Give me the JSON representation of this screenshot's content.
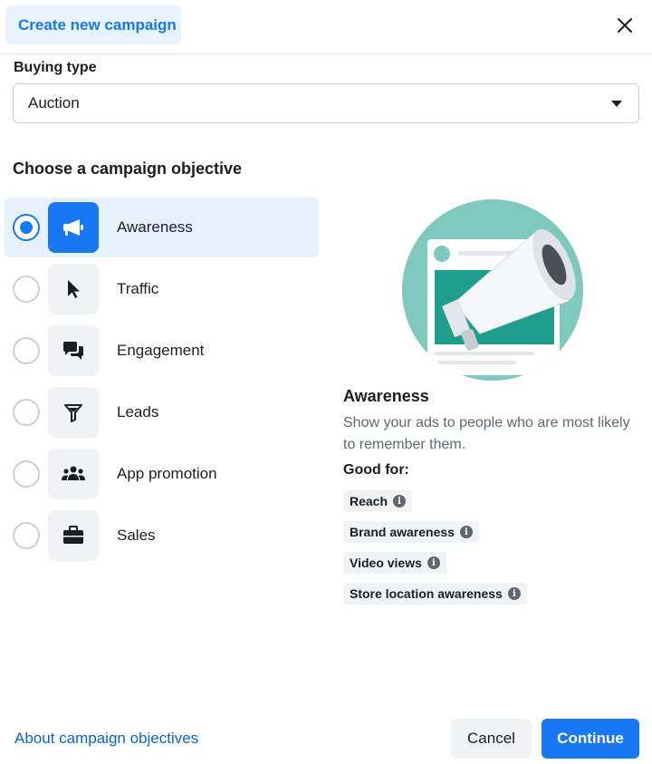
{
  "header": {
    "title": "Create new campaign",
    "close_icon": "close-icon"
  },
  "buying_type": {
    "label": "Buying type",
    "value": "Auction"
  },
  "objective": {
    "section_title": "Choose a campaign objective",
    "items": [
      {
        "label": "Awareness",
        "icon": "megaphone-icon",
        "selected": true
      },
      {
        "label": "Traffic",
        "icon": "cursor-icon",
        "selected": false
      },
      {
        "label": "Engagement",
        "icon": "chat-bubbles-icon",
        "selected": false
      },
      {
        "label": "Leads",
        "icon": "funnel-icon",
        "selected": false
      },
      {
        "label": "App promotion",
        "icon": "people-icon",
        "selected": false
      },
      {
        "label": "Sales",
        "icon": "briefcase-icon",
        "selected": false
      }
    ]
  },
  "detail": {
    "title": "Awareness",
    "description": "Show your ads to people who are most likely to remember them.",
    "good_for_label": "Good for:",
    "chips": [
      "Reach",
      "Brand awareness",
      "Video views",
      "Store location awareness"
    ],
    "info_glyph": "i"
  },
  "footer": {
    "about_link": "About campaign objectives",
    "cancel_label": "Cancel",
    "continue_label": "Continue"
  },
  "colors": {
    "accent": "#1877f2",
    "selected_bg": "#e7f0fd",
    "teal": "#7ec8bd",
    "teal_dark": "#1f9e8e"
  }
}
